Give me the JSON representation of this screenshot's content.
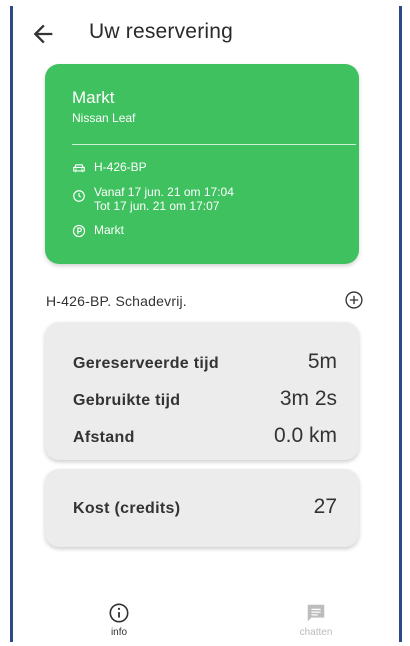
{
  "header": {
    "title": "Uw reservering",
    "back_icon": "arrow-left-icon"
  },
  "reservation_card": {
    "location": "Markt",
    "car_model": "Nissan Leaf",
    "plate": "H-426-BP",
    "from_text": "Vanaf 17 jun. 21 om 17:04",
    "to_text": "Tot 17 jun. 21 om 17:07",
    "parking": "Markt",
    "color": "#3fc15f"
  },
  "damage_status": {
    "text": "H-426-BP. Schadevrij.",
    "add_icon": "plus-circle-icon"
  },
  "usage": {
    "rows": [
      {
        "label": "Gereserveerde tijd",
        "value": "5m"
      },
      {
        "label": "Gebruikte tijd",
        "value": "3m 2s"
      },
      {
        "label": "Afstand",
        "value": "0.0 km"
      }
    ]
  },
  "cost": {
    "label": "Kost (credits)",
    "value": "27"
  },
  "bottom_nav": {
    "items": [
      {
        "label": "info",
        "icon": "info-icon",
        "active": true
      },
      {
        "label": "chatten",
        "icon": "chat-icon",
        "active": false
      }
    ]
  }
}
